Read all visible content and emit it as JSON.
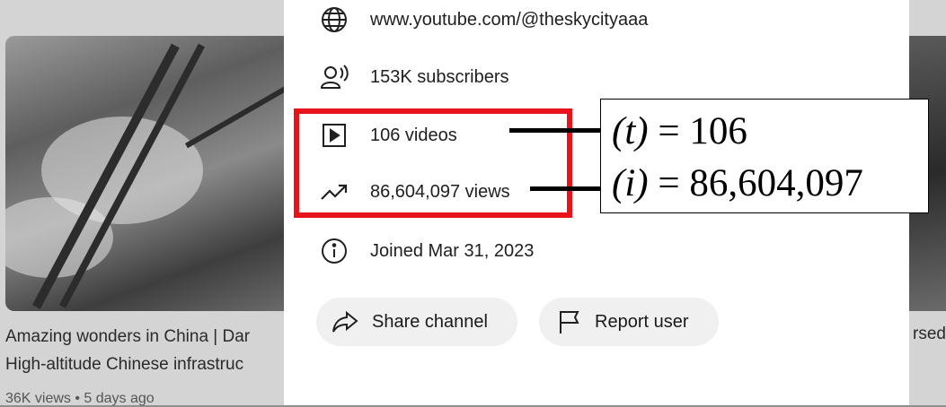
{
  "background": {
    "left_video": {
      "title_line1": "Amazing wonders in China | Dar",
      "title_line2": "High-altitude Chinese infrastruc",
      "meta": "36K views • 5 days ago"
    },
    "right_video": {
      "title_fragment": "rsed"
    }
  },
  "about": {
    "rows": [
      {
        "icon": "globe-icon",
        "text": "www.youtube.com/@theskycityaaa"
      },
      {
        "icon": "subscribers-icon",
        "text": "153K subscribers"
      },
      {
        "icon": "video-play-icon",
        "text": "106 videos"
      },
      {
        "icon": "trending-icon",
        "text": "86,604,097 views"
      },
      {
        "icon": "info-icon",
        "text": "Joined Mar 31, 2023"
      }
    ],
    "buttons": {
      "share": {
        "icon": "share-icon",
        "label": "Share channel"
      },
      "report": {
        "icon": "flag-icon",
        "label": "Report user"
      }
    }
  },
  "annotation": {
    "highlight_color": "#e8141c",
    "formula_t_var": "(t)",
    "formula_t_rest": " = 106",
    "formula_i_var": "(i)",
    "formula_i_rest": " = 86,604,097"
  }
}
